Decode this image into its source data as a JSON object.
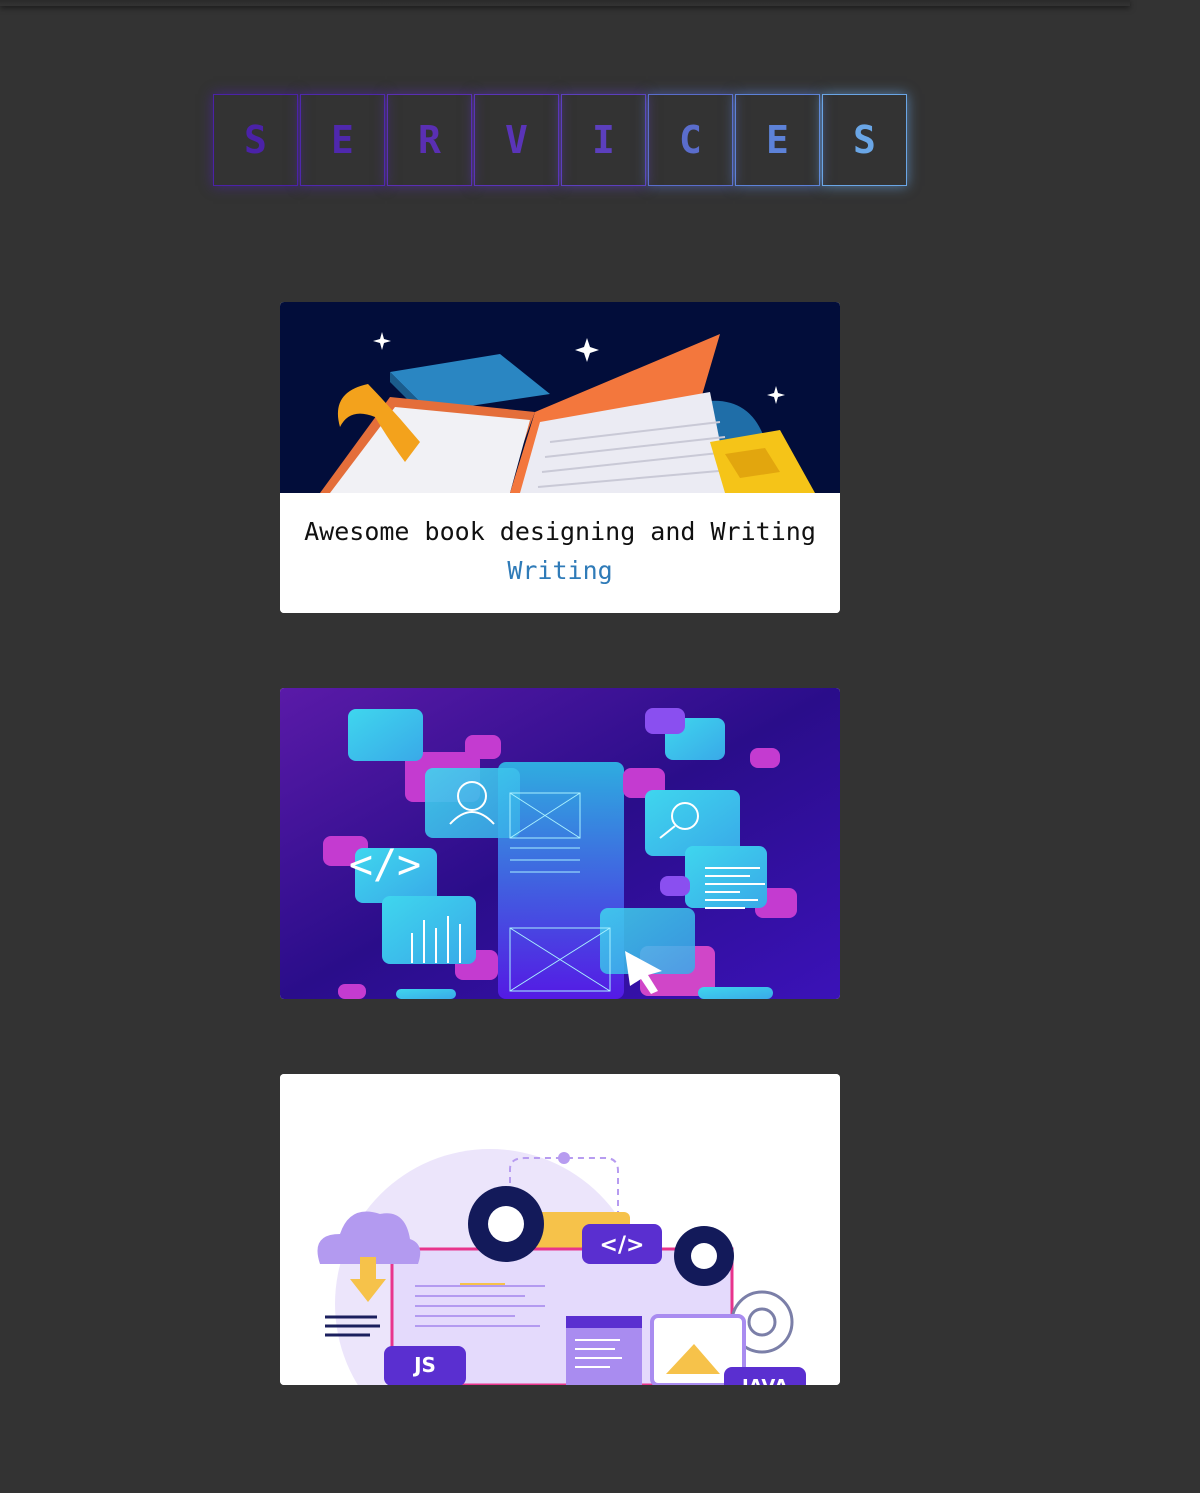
{
  "heading": {
    "letters": [
      "S",
      "E",
      "R",
      "V",
      "I",
      "C",
      "E",
      "S"
    ],
    "colors": [
      "#4b22a8",
      "#4f28ad",
      "#5a2fb3",
      "#5a34b8",
      "#5c3fbd",
      "#5a6dcc",
      "#5d82d8",
      "#6aa6e6"
    ]
  },
  "cards": [
    {
      "illustration": "book-illustration",
      "title": "Awesome book designing and Writing",
      "link": "Writing"
    },
    {
      "illustration": "ui-wireframe-illustration"
    },
    {
      "illustration": "coding-illustration"
    }
  ],
  "colors": {
    "page_bg": "#333333",
    "card_bg": "#ffffff",
    "link": "#2f7bb8",
    "book_bg": "#020d3a",
    "ui_bg": "#3a0f9e"
  }
}
